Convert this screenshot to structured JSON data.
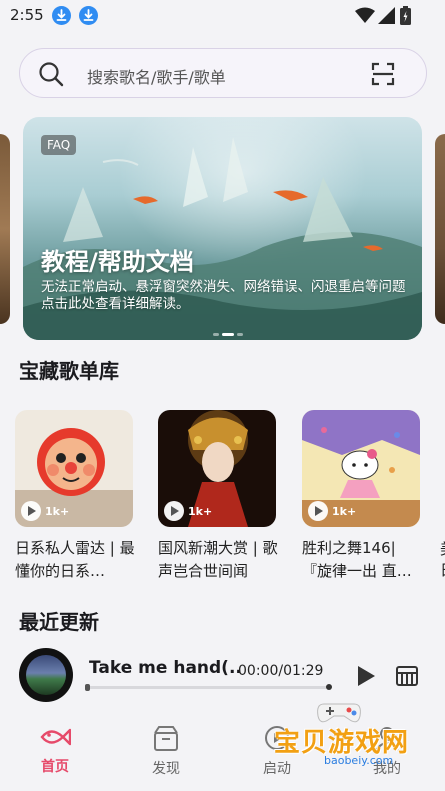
{
  "status_bar": {
    "time": "2:55"
  },
  "search": {
    "placeholder": "搜索歌名/歌手/歌单"
  },
  "banner": {
    "badge": "FAQ",
    "title": "教程/帮助文档",
    "description": "无法正常启动、悬浮窗突然消失、网络错误、闪退重启等问题点击此处查看详细解读。"
  },
  "sections": {
    "playlists_title": "宝藏歌单库",
    "recent_title": "最近更新"
  },
  "playlists": [
    {
      "name": "日系私人雷达 | 最懂你的日系…",
      "plays": "1k+"
    },
    {
      "name": "国风新潮大赏 | 歌声岂合世间闻",
      "plays": "1k+"
    },
    {
      "name": "胜利之舞146| 『旋律一出 直…",
      "plays": "1k+"
    }
  ],
  "partial_playlist": {
    "name": "美日"
  },
  "player": {
    "title": "Take me hand(..",
    "time": "00:00/01:29",
    "progress": 0.0
  },
  "nav": {
    "items": [
      {
        "label": "首页",
        "icon": "fish-home-icon"
      },
      {
        "label": "发现",
        "icon": "discover-box-icon"
      },
      {
        "label": "启动",
        "icon": "launch-icon"
      },
      {
        "label": "我的",
        "icon": "profile-icon"
      }
    ]
  },
  "watermark": {
    "text": "宝贝游戏网",
    "url": "baobeiy.com"
  },
  "colors": {
    "accent": "#e64a6a",
    "download_badge": "#2f8cf2"
  }
}
